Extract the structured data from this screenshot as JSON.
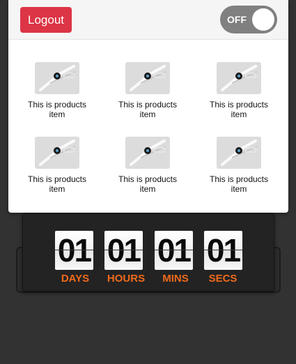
{
  "header": {
    "logout_label": "Logout",
    "toggle_label": "OFF"
  },
  "products": [
    {
      "label": "This is products item",
      "icon": "watch-product-icon"
    },
    {
      "label": "This is products item",
      "icon": "watch-product-icon"
    },
    {
      "label": "This is products item",
      "icon": "watch-product-icon"
    },
    {
      "label": "This is products item",
      "icon": "watch-product-icon"
    },
    {
      "label": "This is products item",
      "icon": "watch-product-icon"
    },
    {
      "label": "This is products item",
      "icon": "watch-product-icon"
    }
  ],
  "countdown": {
    "days": "01",
    "hours": "01",
    "mins": "01",
    "secs": "01",
    "days_label": "DAYS",
    "hours_label": "HOURS",
    "mins_label": "MINS",
    "secs_label": "SECS"
  },
  "colors": {
    "logout_button": "#dc3545",
    "toggle_off": "#808080",
    "unit_label": "#ef6a1b",
    "background": "#323232"
  }
}
